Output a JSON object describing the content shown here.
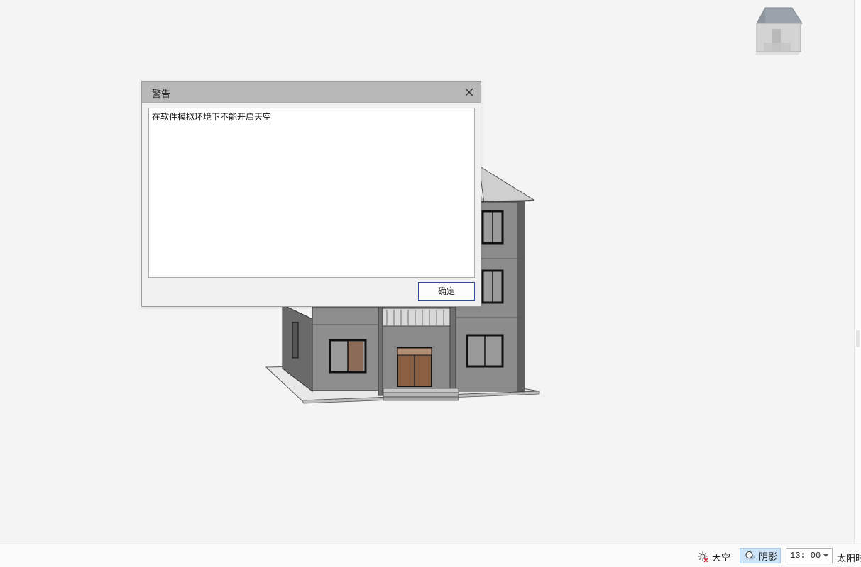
{
  "dialog": {
    "title": "警告",
    "message": "在软件模拟环境下不能开启天空",
    "ok_label": "确定",
    "close_icon": "close-icon"
  },
  "statusbar": {
    "sky_label": "天空",
    "sky_icon": "sky-disabled-icon",
    "shadow_label": "阴影",
    "shadow_icon": "shadow-icon",
    "shadow_active": true,
    "time_value": "13: 00",
    "sun_label": "太阳时"
  },
  "colors": {
    "viewport_bg": "#f4f4f4",
    "titlebar_bg": "#b8b8b8",
    "active_toggle_bg": "#cde3f7",
    "ok_border": "#2f4f8f"
  }
}
